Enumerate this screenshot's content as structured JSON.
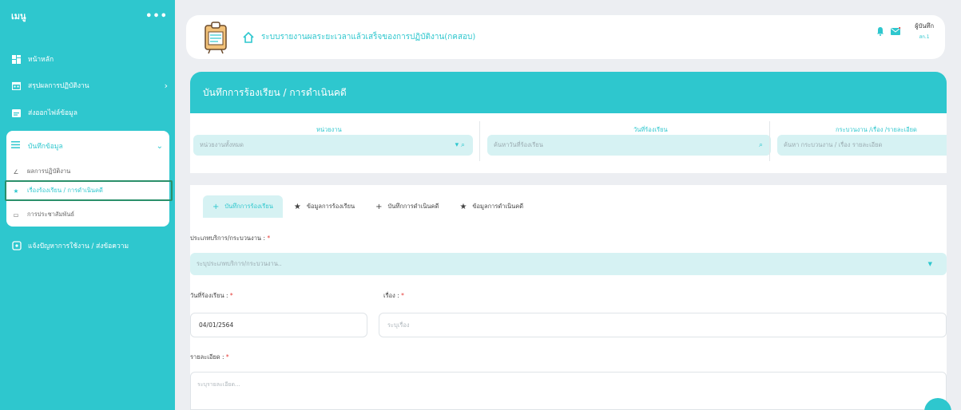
{
  "sidebar": {
    "title": "เมนู",
    "more": "•••",
    "items": [
      {
        "label": "หน้าหลัก",
        "icon": "dashboard-icon"
      },
      {
        "label": "สรุปผลการปฏิบัติงาน",
        "icon": "calendar-icon",
        "chevron": "›"
      },
      {
        "label": "ส่งออกไฟล์ข้อมูล",
        "icon": "calendar-check-icon"
      }
    ],
    "group": {
      "label": "บันทึกข้อมูล",
      "icon": "list-icon",
      "chevron": "⌄",
      "children": [
        {
          "label": "ผลการปฏิบัติงาน",
          "icon": "pencil-icon",
          "glyph": "∠"
        },
        {
          "label": "เรื่องร้องเรียน / การดำเนินคดี",
          "icon": "gavel-icon",
          "glyph": "★"
        },
        {
          "label": "การประชาสัมพันธ์",
          "icon": "broadcast-icon",
          "glyph": "▭"
        }
      ]
    },
    "footer_item": {
      "label": "แจ้งปัญหาการใช้งาน / ส่งข้อความ",
      "icon": "message-icon"
    }
  },
  "topbar": {
    "title": "ระบบรายงานผลระยะเวลาแล้วเสร็จของการปฏิบัติงาน(กคสอบ)",
    "user_name": "ผู้บันทึก",
    "user_sub": "สก.1"
  },
  "banner": {
    "title": "บันทึกการร้องเรียน / การดำเนินคดี"
  },
  "filters": [
    {
      "label": "หน่วยงาน",
      "value": "หน่วยงานทั้งหมด",
      "suffix": "▾  ⌕"
    },
    {
      "label": "วันที่ร้องเรียน",
      "value": "ค้นหาวันที่ร้องเรียน",
      "suffix": "⌕"
    },
    {
      "label": "กระบวนงาน /เรื่อง /รายละเอียด",
      "value": "ค้นหา กระบวนงาน / เรื่อง รายละเอียด",
      "suffix": ""
    }
  ],
  "tabs": [
    {
      "label": "บันทึกการร้องเรียน",
      "glyph": "+"
    },
    {
      "label": "ข้อมูลการร้องเรียน",
      "glyph": "★"
    },
    {
      "label": "บันทึกการดำเนินคดี",
      "glyph": "+"
    },
    {
      "label": "ข้อมูลการดำเนินคดี",
      "glyph": "★"
    }
  ],
  "form": {
    "service_label": "ประเภทบริการ/กระบวนงาน :",
    "service_placeholder": "ระบุประเภทบริการ/กระบวนงาน..",
    "date_label": "วันที่ร้องเรียน :",
    "date_value": "04/01/2564",
    "subject_label": "เรื่อง :",
    "subject_placeholder": "ระบุเรื่อง",
    "detail_label": "รายละเอียด :",
    "detail_placeholder": "ระบุรายละเอียด...",
    "required_mark": "*"
  },
  "colors": {
    "accent": "#2ec7ce",
    "highlight": "#2a8f6a",
    "required": "#e53935"
  }
}
